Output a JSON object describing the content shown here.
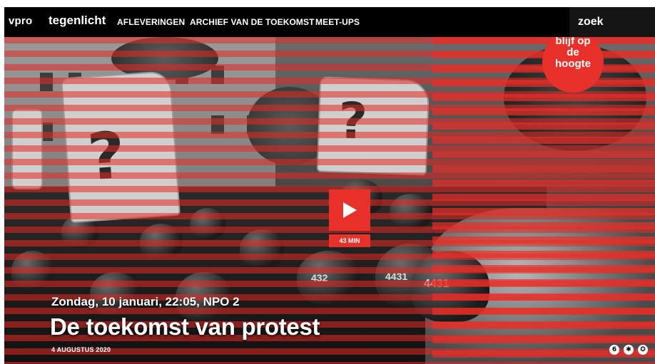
{
  "nav": {
    "vpro": "vpro",
    "brand": "tegenlicht",
    "links": [
      "AFLEVERINGEN",
      "ARCHIEF VAN DE TOEKOMST",
      "MEET-UPS"
    ],
    "search_placeholder": "zoek"
  },
  "hero": {
    "badge": [
      "blijf op",
      "de",
      "hoogte"
    ],
    "duration": "43 MIN",
    "airtime": "Zondag, 10 januari, 22:05, NPO 2",
    "title": "De toekomst van protest",
    "date": "4 AUGUSTUS 2020",
    "sign_text": "?",
    "helmet_numbers": [
      "432",
      "4431",
      "4431"
    ],
    "access_icons": [
      "age-6-icon",
      "violence-icon",
      "fear-icon"
    ],
    "access_labels": [
      "6",
      "✱",
      "✪"
    ]
  },
  "colors": {
    "accent": "#e8312a",
    "nav_bg": "#000000"
  }
}
